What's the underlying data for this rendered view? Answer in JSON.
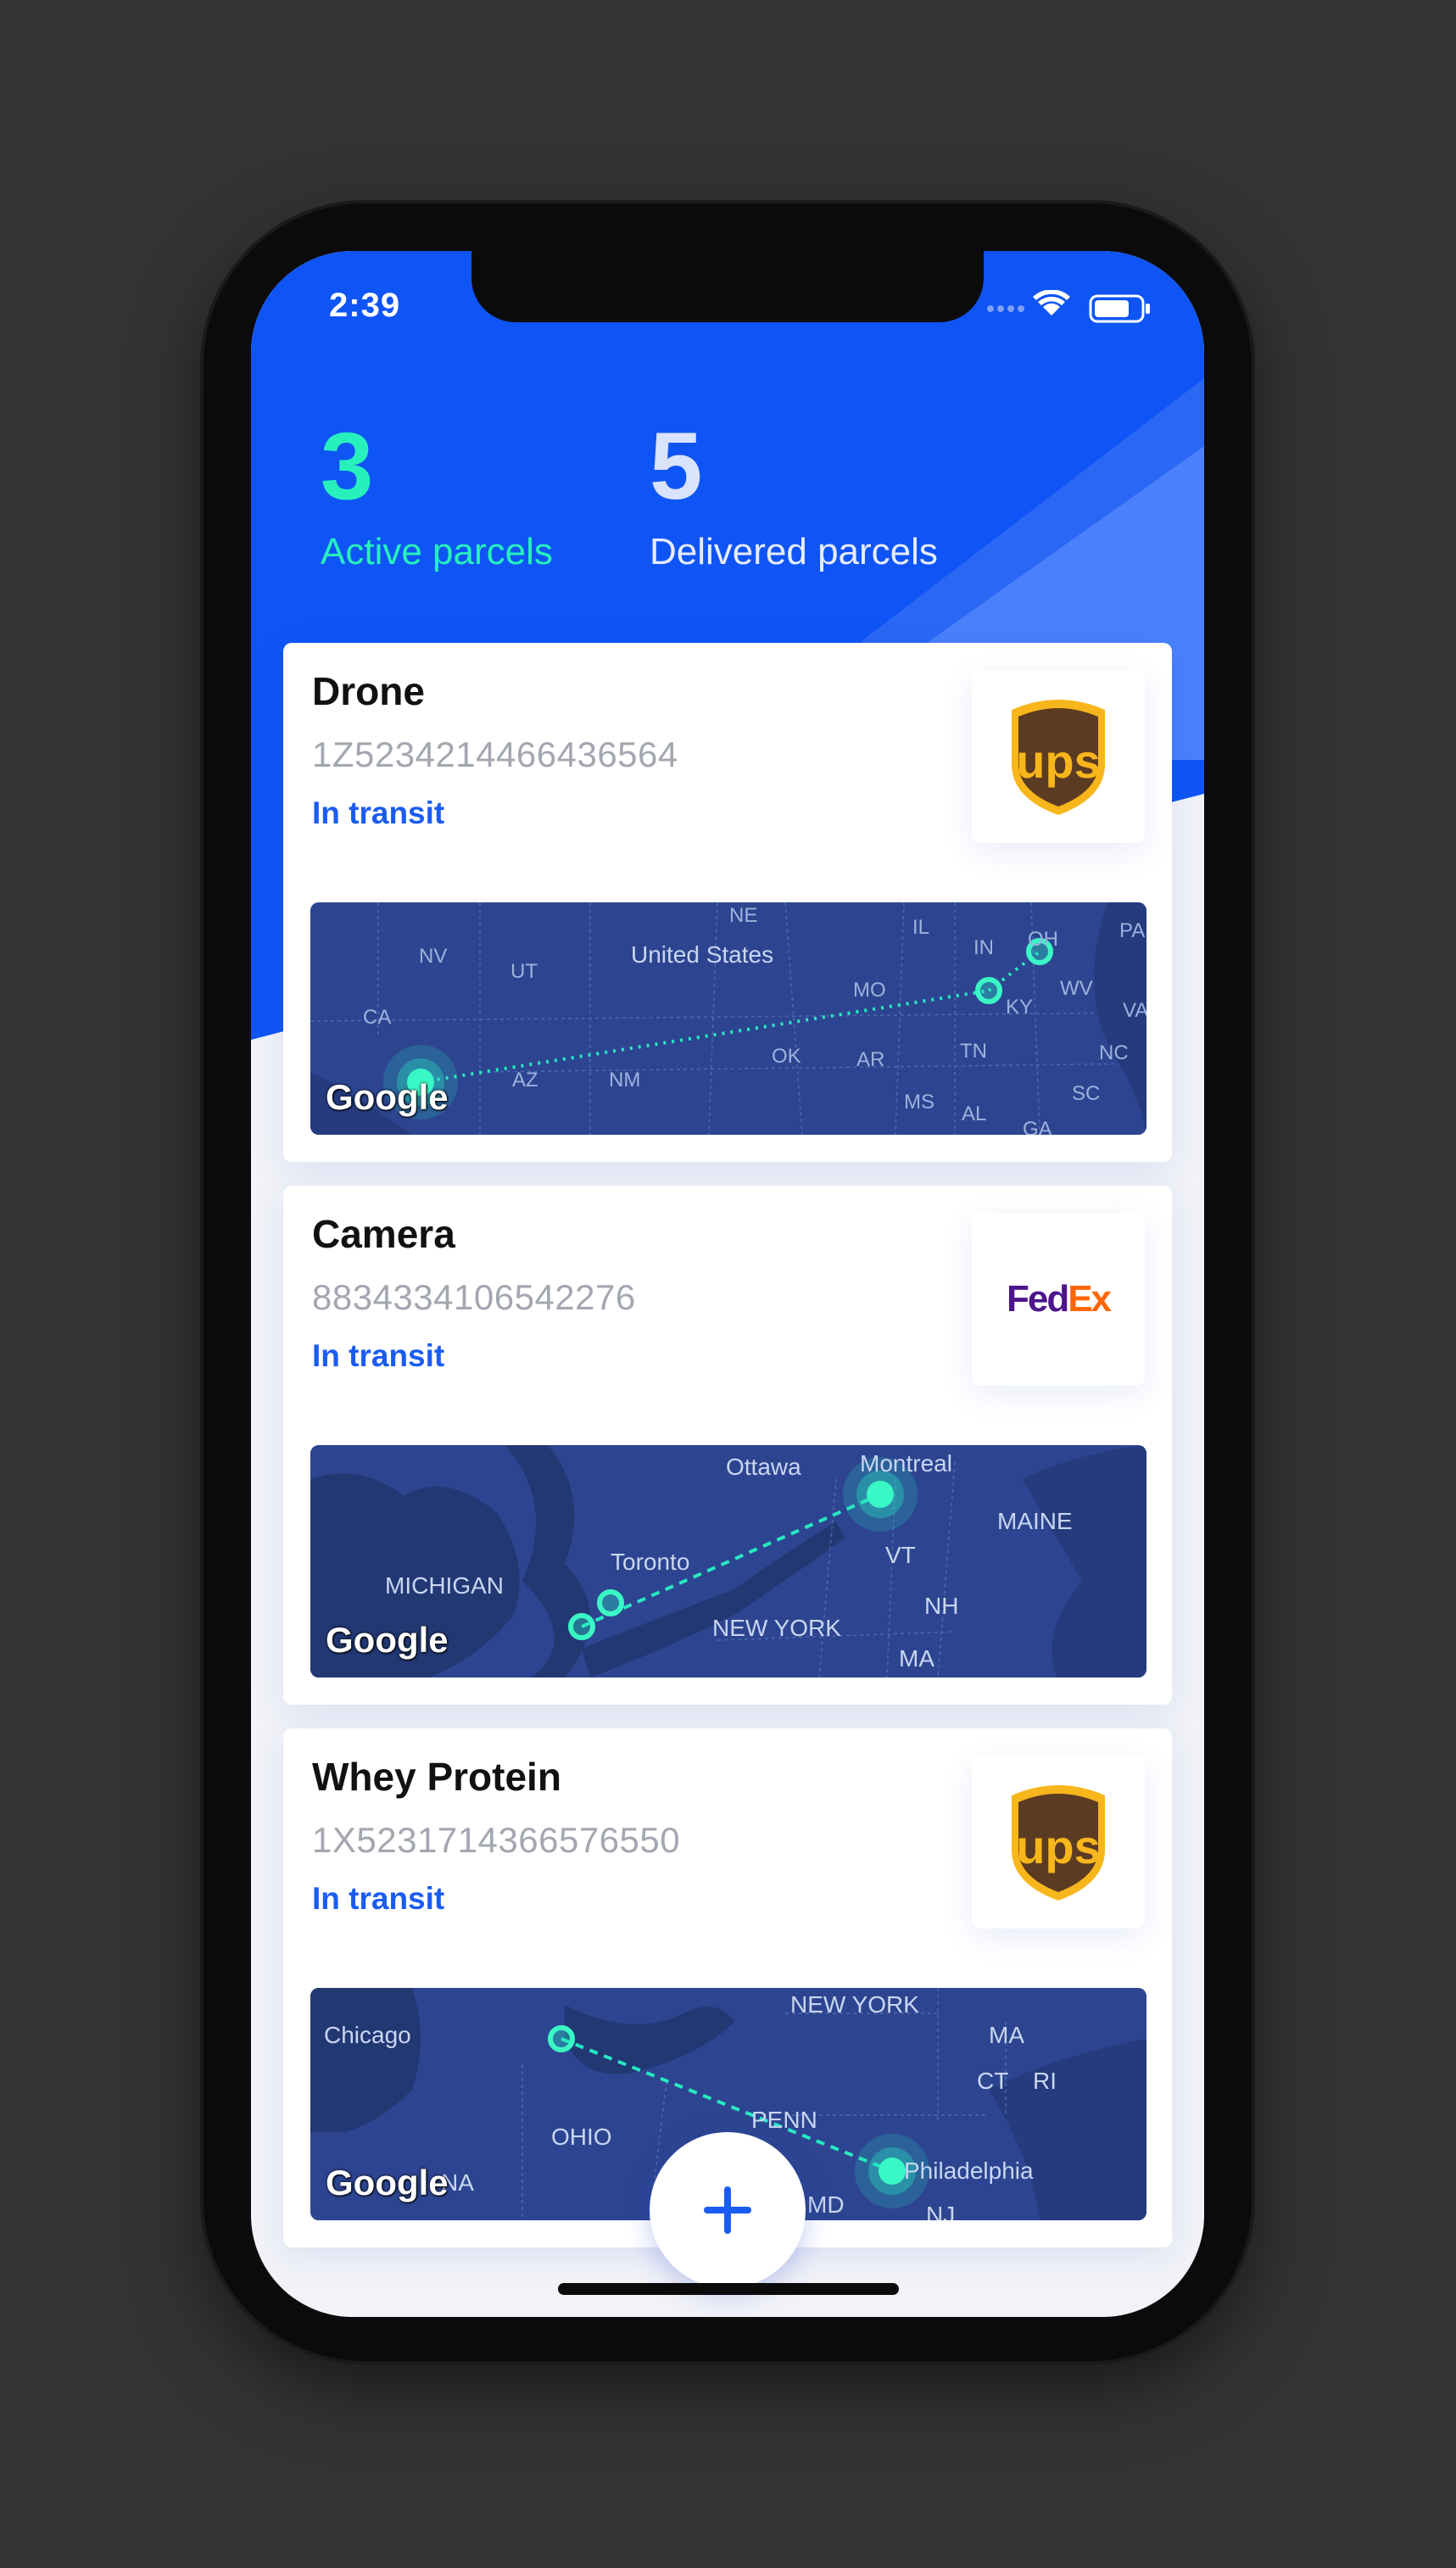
{
  "status_bar": {
    "time": "2:39"
  },
  "summary": {
    "active_count": "3",
    "active_label": "Active parcels",
    "delivered_count": "5",
    "delivered_label": "Delivered parcels"
  },
  "parcels": [
    {
      "title": "Drone",
      "tracking": "1Z5234214466436564",
      "status": "In transit",
      "carrier": "ups",
      "map_labels": [
        "NE",
        "IL",
        "IN",
        "OH",
        "PA",
        "NV",
        "UT",
        "United States",
        "MO",
        "KY",
        "WV",
        "VA",
        "CA",
        "AZ",
        "NM",
        "OK",
        "AR",
        "TN",
        "NC",
        "SC",
        "MS",
        "AL",
        "GA"
      ]
    },
    {
      "title": "Camera",
      "tracking": "8834334106542276",
      "status": "In transit",
      "carrier": "fedex",
      "map_labels": [
        "Ottawa",
        "Montreal",
        "MAINE",
        "Toronto",
        "VT",
        "MICHIGAN",
        "NH",
        "NEW YORK",
        "MA"
      ]
    },
    {
      "title": "Whey Protein",
      "tracking": "1X5231714366576550",
      "status": "In transit",
      "carrier": "ups",
      "map_labels": [
        "NEW YORK",
        "Chicago",
        "MA",
        "CT",
        "RI",
        "PENN",
        "OHIO",
        "NA",
        "Philadelphia",
        "MD",
        "NJ"
      ]
    }
  ],
  "map_attribution": "Google",
  "fedex_logo": {
    "fed": "Fed",
    "ex": "Ex"
  },
  "ups_logo": {
    "text": "ups"
  },
  "colors": {
    "header_blue": "#0f55f5",
    "accent_green": "#27f0bd",
    "status_blue": "#1a5cf2",
    "map_bg": "#2d4590"
  },
  "icons": {
    "fab": "plus-icon",
    "wifi": "wifi-icon",
    "battery": "battery-icon",
    "signal": "signal-icon"
  }
}
